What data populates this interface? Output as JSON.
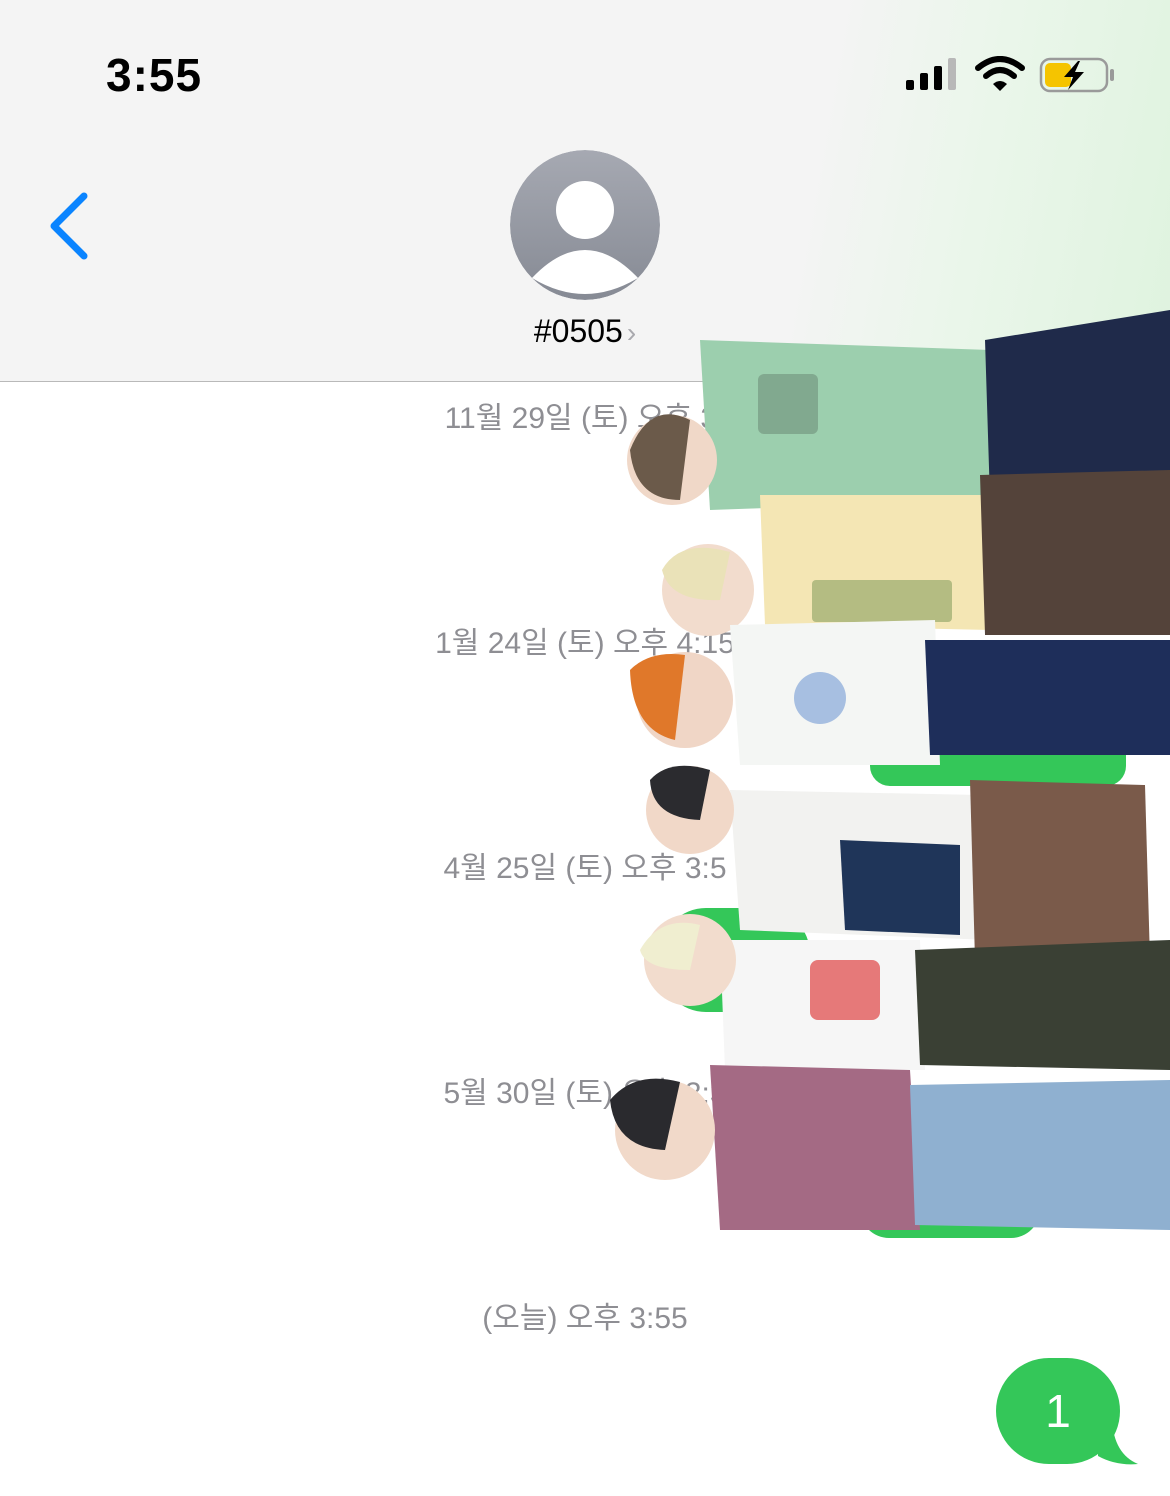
{
  "status_bar": {
    "time": "3:55",
    "signal_icon": "cellular-signal-icon",
    "wifi_icon": "wifi-icon",
    "battery_icon": "battery-charging-icon",
    "battery_fill_fraction": 0.4,
    "battery_color": "#f5c400"
  },
  "header": {
    "back_icon": "chevron-left-icon",
    "avatar_icon": "person-avatar-icon",
    "contact_name": "#0505",
    "contact_chevron": "›",
    "accent_color": "#0a84ff"
  },
  "messages": {
    "timestamps": [
      "11월 29일 (토) 오후 3:",
      "1월 24일 (토) 오후 4:15",
      "4월 25일 (토) 오후 3:5",
      "5월 30일 (토) 오후 3:3",
      "(오늘) 오후 3:55"
    ],
    "sent_bubble_text": "1",
    "bubble_color": "#34c759"
  },
  "overlay": {
    "description_icon": "group-photo-overlay"
  }
}
